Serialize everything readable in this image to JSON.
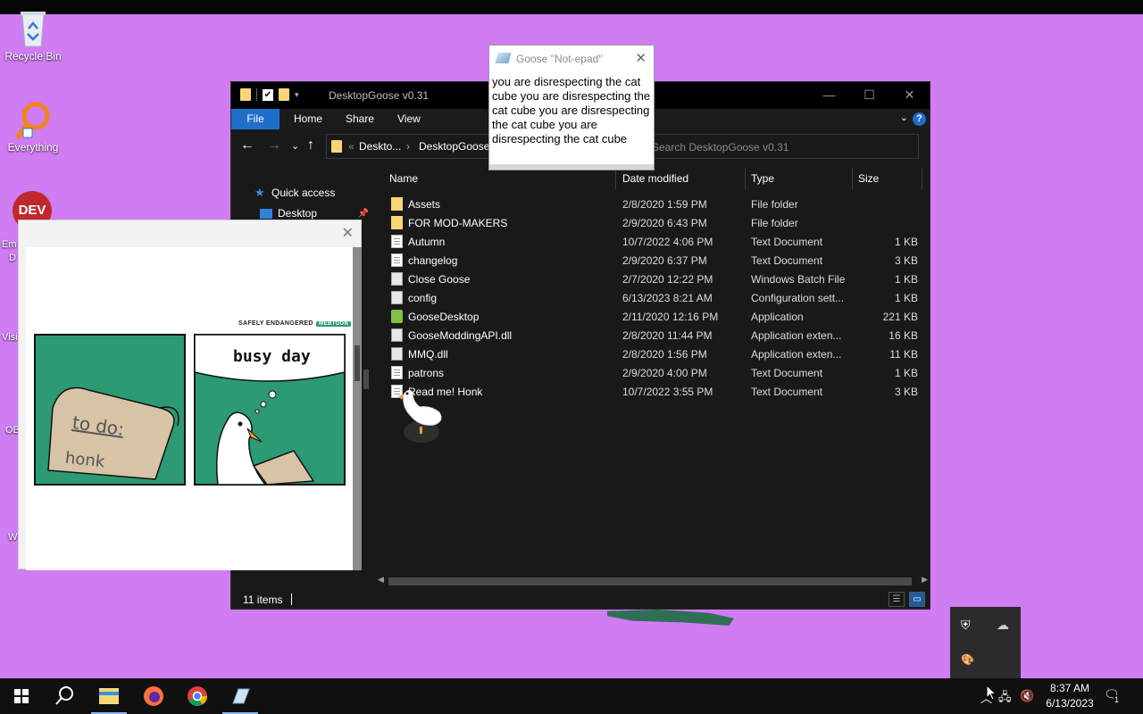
{
  "desktop": {
    "icons": [
      {
        "label": "Recycle Bin"
      },
      {
        "label": "Everything"
      }
    ],
    "partial_labels": [
      "Em",
      "D",
      "Visi",
      "OB",
      "W"
    ]
  },
  "explorer": {
    "title": "DesktopGoose v0.31",
    "ribbon": {
      "file": "File",
      "home": "Home",
      "share": "Share",
      "view": "View"
    },
    "address": {
      "crumb1": "Deskto...",
      "crumb_sep": "›",
      "crumb2": "DesktopGoose",
      "prefix": "«"
    },
    "search_placeholder": "Search DesktopGoose v0.31",
    "nav": {
      "quick_access": "Quick access",
      "desktop": "Desktop"
    },
    "columns": {
      "name": "Name",
      "date": "Date modified",
      "type": "Type",
      "size": "Size"
    },
    "files": [
      {
        "name": "Assets",
        "date": "2/8/2020 1:59 PM",
        "type": "File folder",
        "size": "",
        "icon": "folder-icon"
      },
      {
        "name": "FOR MOD-MAKERS",
        "date": "2/9/2020 6:43 PM",
        "type": "File folder",
        "size": "",
        "icon": "folder-icon"
      },
      {
        "name": "Autumn",
        "date": "10/7/2022 4:06 PM",
        "type": "Text Document",
        "size": "1 KB",
        "icon": "text-file-icon"
      },
      {
        "name": "changelog",
        "date": "2/9/2020 6:37 PM",
        "type": "Text Document",
        "size": "3 KB",
        "icon": "text-file-icon"
      },
      {
        "name": "Close Goose",
        "date": "2/7/2020 12:22 PM",
        "type": "Windows Batch File",
        "size": "1 KB",
        "icon": "gear-file-icon"
      },
      {
        "name": "config",
        "date": "6/13/2023 8:21 AM",
        "type": "Configuration sett...",
        "size": "1 KB",
        "icon": "gear-file-icon"
      },
      {
        "name": "GooseDesktop",
        "date": "2/11/2020 12:16 PM",
        "type": "Application",
        "size": "221 KB",
        "icon": "app-icon"
      },
      {
        "name": "GooseModdingAPI.dll",
        "date": "2/8/2020 11:44 PM",
        "type": "Application exten...",
        "size": "16 KB",
        "icon": "dll-icon"
      },
      {
        "name": "MMQ.dll",
        "date": "2/8/2020 1:56 PM",
        "type": "Application exten...",
        "size": "11 KB",
        "icon": "dll-icon"
      },
      {
        "name": "patrons",
        "date": "2/9/2020 4:00 PM",
        "type": "Text Document",
        "size": "1 KB",
        "icon": "text-file-icon"
      },
      {
        "name": "Read me! Honk",
        "date": "10/7/2022 3:55 PM",
        "type": "Text Document",
        "size": "3 KB",
        "icon": "text-file-icon"
      }
    ],
    "status": "11 items"
  },
  "notepad": {
    "title": "Goose \"Not-epad\"",
    "text": "you are disrespecting the cat cube you are disrespecting the cat cube you are disrespecting the cat cube you are disrespecting the cat cube"
  },
  "meme": {
    "header": "SAFELY ENDANGERED",
    "badge": "WEBTOON",
    "panel1_line1": "to do:",
    "panel1_line2": "honk",
    "panel2_caption": "busy day"
  },
  "taskbar": {
    "time": "8:37 AM",
    "date": "6/13/2023",
    "notif_count": "1"
  },
  "colors": {
    "desktop_bg": "#d07cf3",
    "accent": "#1f6fca",
    "meme_green": "#2c9a72"
  }
}
